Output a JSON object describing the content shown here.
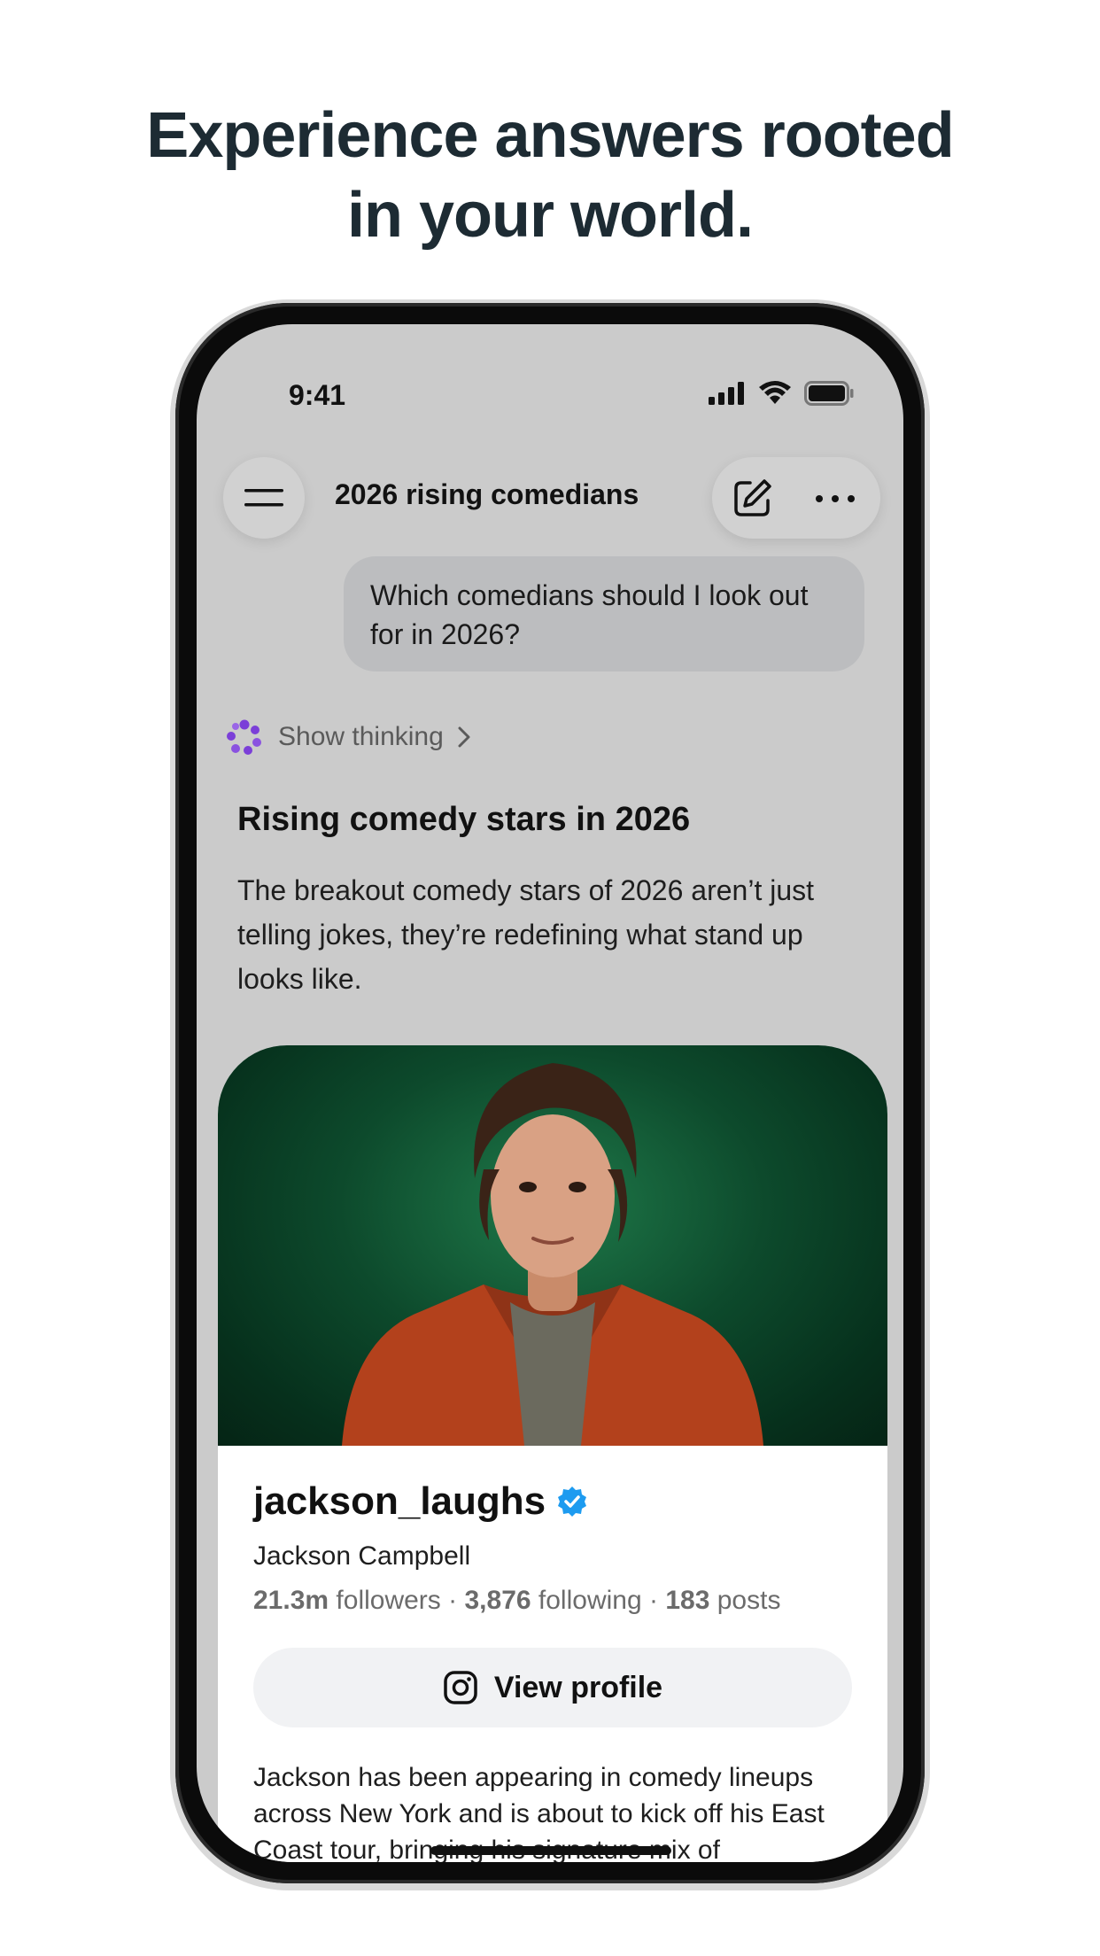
{
  "headline": {
    "line1": "Experience answers rooted",
    "line2": "in your world."
  },
  "status_bar": {
    "time": "9:41",
    "icons": [
      "signal-icon",
      "wifi-icon",
      "battery-icon"
    ]
  },
  "top_bar": {
    "title": "2026 rising comedians",
    "menu_icon": "hamburger-menu-icon",
    "edit_icon": "compose-icon",
    "more_icon": "more-dots-icon"
  },
  "chat": {
    "user_message": "Which comedians should I look out for in 2026?",
    "thinking_label": "Show thinking",
    "answer_title": "Rising comedy stars in 2026",
    "answer_body": "The breakout comedy stars of 2026 aren’t just telling jokes, they’re redefining what stand up looks like."
  },
  "profile_card": {
    "username": "jackson_laughs",
    "full_name": "Jackson Campbell",
    "followers_count": "21.3m",
    "followers_label": "followers",
    "following_count": "3,876",
    "following_label": "following",
    "posts_count": "183",
    "posts_label": "posts",
    "separator": "·",
    "view_button_label": "View profile",
    "description": "Jackson has been appearing in comedy lineups across New York and is about to kick off his East Coast tour, bringing his signature mix of"
  },
  "colors": {
    "screen_background": "#cbcbcb",
    "verified_badge": "#1d9bf0",
    "thinking_icon": "#7b3fd8",
    "photo_background": "#0d4a2c",
    "headline": "#1d2b33"
  }
}
